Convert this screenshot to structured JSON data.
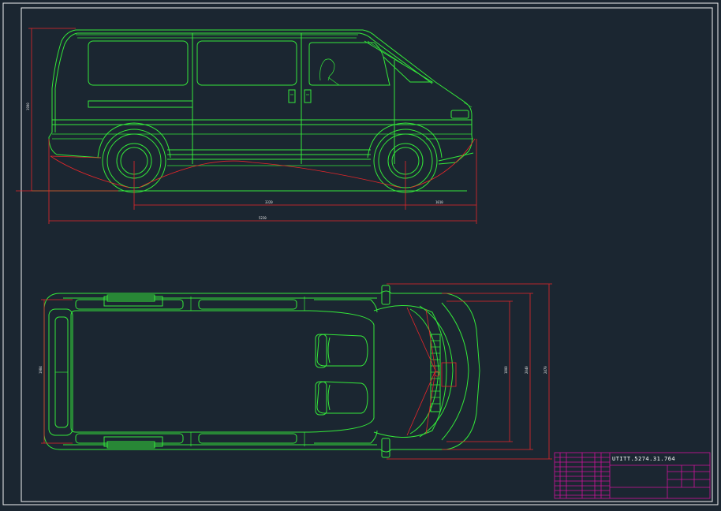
{
  "colors": {
    "background": "#1b2631",
    "geometry": "#34e83a",
    "dimensions": "#e8262a",
    "frame": "#f2f2f2",
    "title_block": "#d0149c"
  },
  "drawing": {
    "title_block": {
      "drawing_number": "UTITT.5274.31.764"
    }
  }
}
